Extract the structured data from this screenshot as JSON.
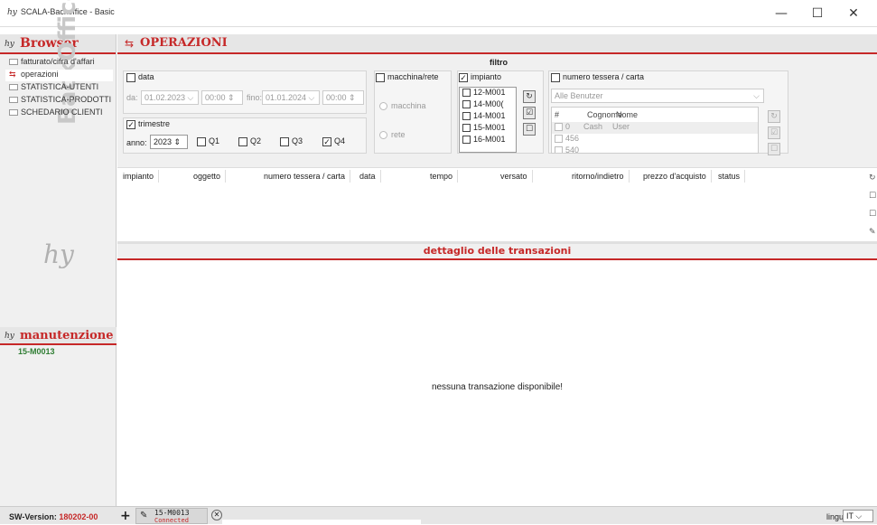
{
  "window": {
    "title": "SCALA-Backoffice - Basic",
    "controls": {
      "minimize": "—",
      "maximize": "☐",
      "close": "✕"
    }
  },
  "browser": {
    "title": "Browser",
    "logo": "hy",
    "items": [
      {
        "label": "fatturato/cifra d'affari",
        "icon": "chart-icon"
      },
      {
        "label": "operazioni",
        "icon": "arrows-icon",
        "selected": true
      },
      {
        "label": "STATISTICA-UTENTI",
        "icon": "chart-icon"
      },
      {
        "label": "STATISTICA-PRODOTTI",
        "icon": "chart-icon"
      },
      {
        "label": "SCHEDARIO CLIENTI",
        "icon": "people-icon"
      }
    ],
    "watermark": "BackOffice"
  },
  "maintenance": {
    "title": "manutenzione",
    "logo": "hy",
    "items": [
      "15-M0013"
    ]
  },
  "main": {
    "title": "OPERAZIONI",
    "filter_title": "filtro",
    "date": {
      "label": "data",
      "from_label": "da:",
      "from_date": "01.02.2023",
      "from_time": "00:00",
      "to_label": "fino:",
      "to_date": "01.01.2024",
      "to_time": "00:00"
    },
    "quarter": {
      "label": "trimestre",
      "checked": true,
      "year_label": "anno:",
      "year": "2023",
      "q1": "Q1",
      "q2": "Q2",
      "q3": "Q3",
      "q4": "Q4"
    },
    "machine": {
      "label": "macchina/rete",
      "opt_machine": "macchina",
      "opt_network": "rete"
    },
    "plant": {
      "label": "impianto",
      "checked": true,
      "items": [
        "12-M001",
        "14-M00(",
        "14-M001",
        "15-M001",
        "16-M001"
      ]
    },
    "card": {
      "label": "numero tessera / carta",
      "select_value": "Alle Benutzer",
      "col_num": "#",
      "col_surname": "Cognome",
      "col_name": "Nome",
      "rows": [
        {
          "num": "0",
          "surname": "Cash",
          "name": "User"
        },
        {
          "num": "456",
          "surname": "",
          "name": ""
        },
        {
          "num": "540",
          "surname": "",
          "name": ""
        }
      ]
    },
    "table": {
      "columns": [
        "impianto",
        "oggetto",
        "numero tessera / carta",
        "data",
        "tempo",
        "versato",
        "ritorno/indietro",
        "prezzo d'acquisto",
        "status"
      ]
    },
    "detail_title": "dettaglio delle transazioni",
    "empty_message": "nessuna transazione disponibile!"
  },
  "status": {
    "sw_label": "SW-Version:",
    "sw_version": "180202-00",
    "connection_device": "15-M0013",
    "connection_state": "Connected",
    "language_label": "lingua",
    "language": "IT"
  },
  "colors": {
    "accent": "#c62828",
    "green": "#2e7d32",
    "panel": "#f0f0f0"
  }
}
